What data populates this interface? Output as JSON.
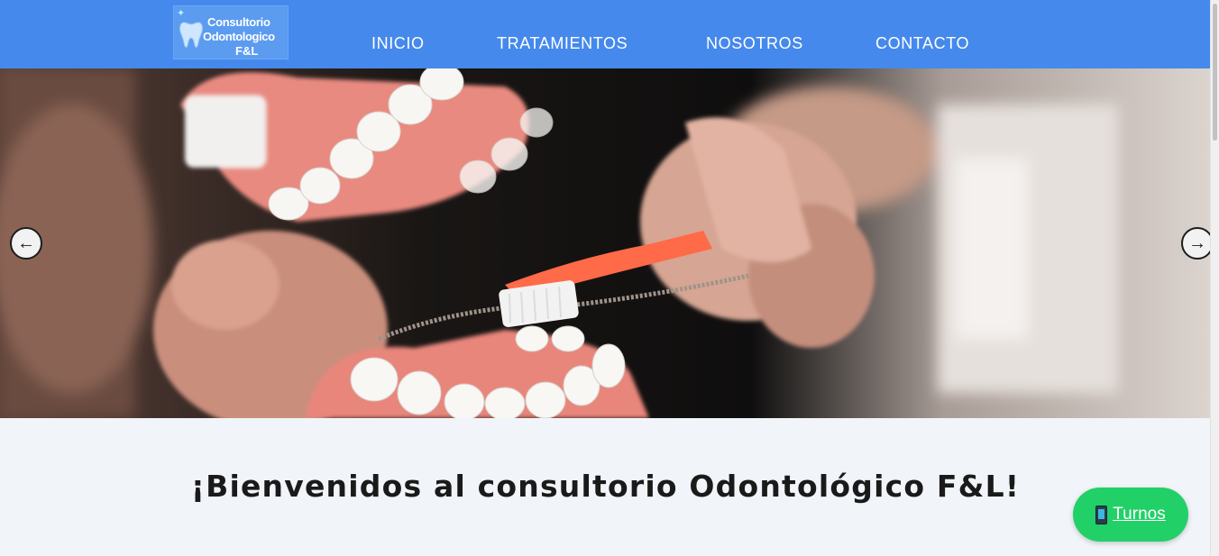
{
  "header": {
    "logo": {
      "line1": "Consultorio",
      "line2": "Odontologico",
      "line3": "F&L"
    },
    "nav": [
      {
        "label": "INICIO"
      },
      {
        "label": "TRATAMIENTOS"
      },
      {
        "label": "NOSOTROS"
      },
      {
        "label": "CONTACTO"
      }
    ],
    "brand_color": "#4589ec"
  },
  "carousel": {
    "prev_icon": "arrow-left-icon",
    "next_icon": "arrow-right-icon",
    "prev_glyph": "←",
    "next_glyph": "→"
  },
  "welcome": {
    "title": "¡Bienvenidos al consultorio Odontológico F&L!"
  },
  "floating_button": {
    "label": "Turnos",
    "icon": "phone-icon",
    "color": "#22d068"
  }
}
